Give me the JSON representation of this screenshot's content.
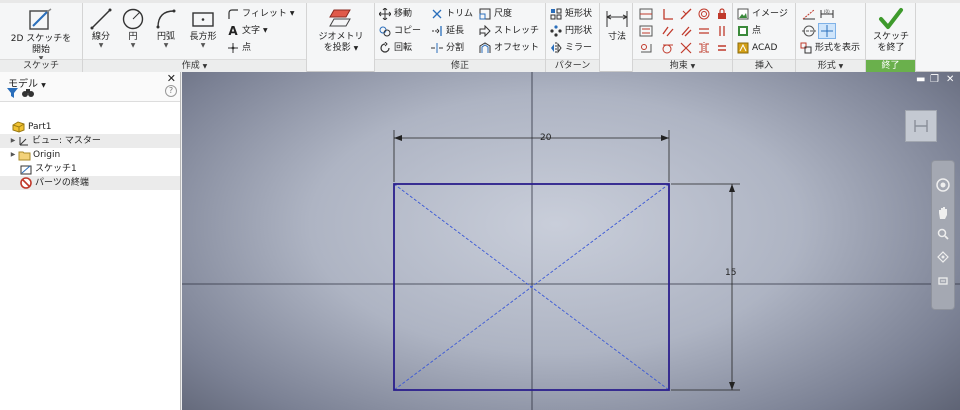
{
  "ribbon": {
    "sketch_panel": {
      "title": "スケッチ",
      "start_label_1": "2D スケッチを",
      "start_label_2": "開始"
    },
    "create_panel": {
      "title": "作成",
      "line": "線分",
      "circle": "円",
      "arc": "円弧",
      "rectangle": "長方形",
      "fillet": "フィレット",
      "text": "文字",
      "point": "点"
    },
    "project_panel": {
      "label_1": "ジオメトリ",
      "label_2": "を投影"
    },
    "modify_panel": {
      "title": "修正",
      "move": "移動",
      "trim": "トリム",
      "scale": "尺度",
      "copy": "コピー",
      "extend": "延長",
      "stretch": "ストレッチ",
      "rotate": "回転",
      "split": "分割",
      "offset": "オフセット"
    },
    "pattern_panel": {
      "title": "パターン",
      "rectangular": "矩形状",
      "circular": "円形状",
      "mirror": "ミラー"
    },
    "dimension": "寸法",
    "constrain_panel": {
      "title": "拘束"
    },
    "insert_panel": {
      "title": "挿入",
      "image": "イメージ",
      "points": "点",
      "acad": "ACAD"
    },
    "format_panel": {
      "title": "形式",
      "show_format": "形式を表示"
    },
    "exit_panel": {
      "title": "終了",
      "label_1": "スケッチ",
      "label_2": "を終了"
    }
  },
  "browser": {
    "title": "モデル",
    "tree": [
      {
        "label": "Part1",
        "expand": "",
        "icon": "part-icon"
      },
      {
        "label": "ビュー: マスター",
        "expand": "▶",
        "icon": "view-icon"
      },
      {
        "label": "Origin",
        "expand": "▶",
        "icon": "folder-icon"
      },
      {
        "label": "スケッチ1",
        "expand": "",
        "icon": "sketch-icon"
      },
      {
        "label": "パーツの終端",
        "expand": "",
        "icon": "end-of-part-icon"
      }
    ]
  },
  "viewport": {
    "dim_width": "20",
    "dim_height": "15"
  },
  "colors": {
    "sketch_line": "#2b1f8c",
    "accent_green": "#6ab04c"
  }
}
